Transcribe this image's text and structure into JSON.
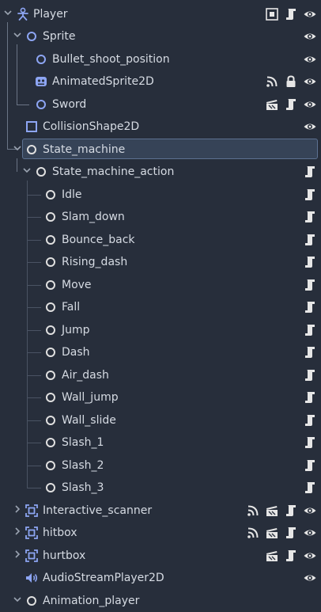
{
  "scene_tree": {
    "nodes": [
      {
        "label": "Player",
        "node_icon": "character-body-icon",
        "expand": "down",
        "right_icons": [
          "group-icon",
          "script-icon",
          "visibility-eye-icon"
        ]
      },
      {
        "label": "Sprite",
        "node_icon": "node-circle-icon",
        "expand": "down",
        "right_icons": [
          "visibility-eye-icon"
        ]
      },
      {
        "label": "Bullet_shoot_position",
        "node_icon": "node-circle-icon",
        "expand": "none",
        "right_icons": [
          "visibility-eye-icon"
        ]
      },
      {
        "label": "AnimatedSprite2D",
        "node_icon": "animated-sprite-icon",
        "expand": "none",
        "right_icons": [
          "signal-icon",
          "lock-icon",
          "visibility-eye-icon"
        ]
      },
      {
        "label": "Sword",
        "node_icon": "node-circle-icon",
        "expand": "none",
        "right_icons": [
          "scene-instance-icon",
          "script-icon",
          "visibility-eye-icon"
        ]
      },
      {
        "label": "CollisionShape2D",
        "node_icon": "collision-shape-icon",
        "expand": "none",
        "right_icons": [
          "visibility-eye-icon"
        ]
      },
      {
        "label": "State_machine",
        "node_icon": "node-circle-icon",
        "expand": "down",
        "right_icons": []
      },
      {
        "label": "State_machine_action",
        "node_icon": "node-circle-icon",
        "expand": "down",
        "right_icons": [
          "script-icon"
        ]
      },
      {
        "label": "Idle",
        "node_icon": "node-circle-icon",
        "expand": "none",
        "right_icons": [
          "script-icon"
        ]
      },
      {
        "label": "Slam_down",
        "node_icon": "node-circle-icon",
        "expand": "none",
        "right_icons": [
          "script-icon"
        ]
      },
      {
        "label": "Bounce_back",
        "node_icon": "node-circle-icon",
        "expand": "none",
        "right_icons": [
          "script-icon"
        ]
      },
      {
        "label": "Rising_dash",
        "node_icon": "node-circle-icon",
        "expand": "none",
        "right_icons": [
          "script-icon"
        ]
      },
      {
        "label": "Move",
        "node_icon": "node-circle-icon",
        "expand": "none",
        "right_icons": [
          "script-icon"
        ]
      },
      {
        "label": "Fall",
        "node_icon": "node-circle-icon",
        "expand": "none",
        "right_icons": [
          "script-icon"
        ]
      },
      {
        "label": "Jump",
        "node_icon": "node-circle-icon",
        "expand": "none",
        "right_icons": [
          "script-icon"
        ]
      },
      {
        "label": "Dash",
        "node_icon": "node-circle-icon",
        "expand": "none",
        "right_icons": [
          "script-icon"
        ]
      },
      {
        "label": "Air_dash",
        "node_icon": "node-circle-icon",
        "expand": "none",
        "right_icons": [
          "script-icon"
        ]
      },
      {
        "label": "Wall_jump",
        "node_icon": "node-circle-icon",
        "expand": "none",
        "right_icons": [
          "script-icon"
        ]
      },
      {
        "label": "Wall_slide",
        "node_icon": "node-circle-icon",
        "expand": "none",
        "right_icons": [
          "script-icon"
        ]
      },
      {
        "label": "Slash_1",
        "node_icon": "node-circle-icon",
        "expand": "none",
        "right_icons": [
          "script-icon"
        ]
      },
      {
        "label": "Slash_2",
        "node_icon": "node-circle-icon",
        "expand": "none",
        "right_icons": [
          "script-icon"
        ]
      },
      {
        "label": "Slash_3",
        "node_icon": "node-circle-icon",
        "expand": "none",
        "right_icons": [
          "script-icon"
        ]
      },
      {
        "label": "Interactive_scanner",
        "node_icon": "area-icon",
        "expand": "right",
        "right_icons": [
          "signal-icon",
          "scene-instance-icon",
          "script-icon",
          "visibility-eye-icon"
        ]
      },
      {
        "label": "hitbox",
        "node_icon": "area-icon",
        "expand": "right",
        "right_icons": [
          "signal-icon",
          "scene-instance-icon",
          "script-icon",
          "visibility-eye-icon"
        ]
      },
      {
        "label": "hurtbox",
        "node_icon": "area-icon",
        "expand": "right",
        "right_icons": [
          "scene-instance-icon",
          "script-icon",
          "visibility-eye-icon"
        ]
      },
      {
        "label": "AudioStreamPlayer2D",
        "node_icon": "speaker-icon",
        "expand": "none",
        "right_icons": [
          "visibility-eye-icon"
        ]
      },
      {
        "label": "Animation_player",
        "node_icon": "node-circle-icon",
        "expand": "down",
        "right_icons": []
      }
    ]
  },
  "colors": {
    "background": "#272e3b",
    "text": "#d6dbe3",
    "node2d_blue": "#8da5f3",
    "node_white": "#e0e0e0",
    "selection_bg": "#364357",
    "selection_border": "#5c7191",
    "guide_line": "#6b7586"
  }
}
